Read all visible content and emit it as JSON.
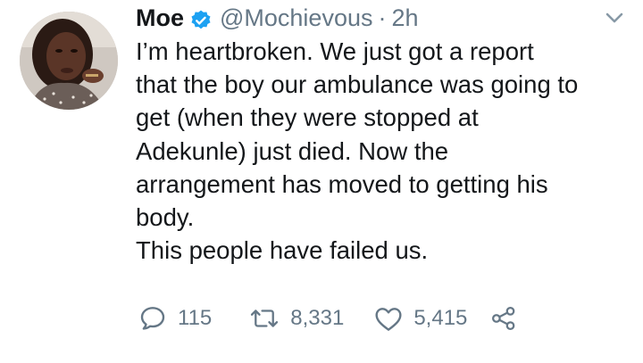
{
  "tweet": {
    "author": {
      "name": "Moe",
      "handle": "@Mochievous",
      "separator": "·",
      "time": "2h",
      "verified": true
    },
    "text_lines": [
      "I’m heartbroken. We just got a report",
      "that the boy our ambulance was going to",
      "get (when they were stopped at",
      "Adekunle) just died. Now the",
      "arrangement has moved to getting his",
      "body.",
      "This people have failed us."
    ],
    "actions": {
      "reply": {
        "icon": "reply-icon",
        "count": "115"
      },
      "retweet": {
        "icon": "retweet-icon",
        "count": "8,331"
      },
      "like": {
        "icon": "heart-icon",
        "count": "5,415"
      },
      "share": {
        "icon": "share-icon"
      }
    },
    "menu_icon": "chevron-down-icon"
  },
  "colors": {
    "text": "#14171a",
    "secondary": "#657786",
    "verified": "#1da1f2",
    "background": "#ffffff"
  }
}
